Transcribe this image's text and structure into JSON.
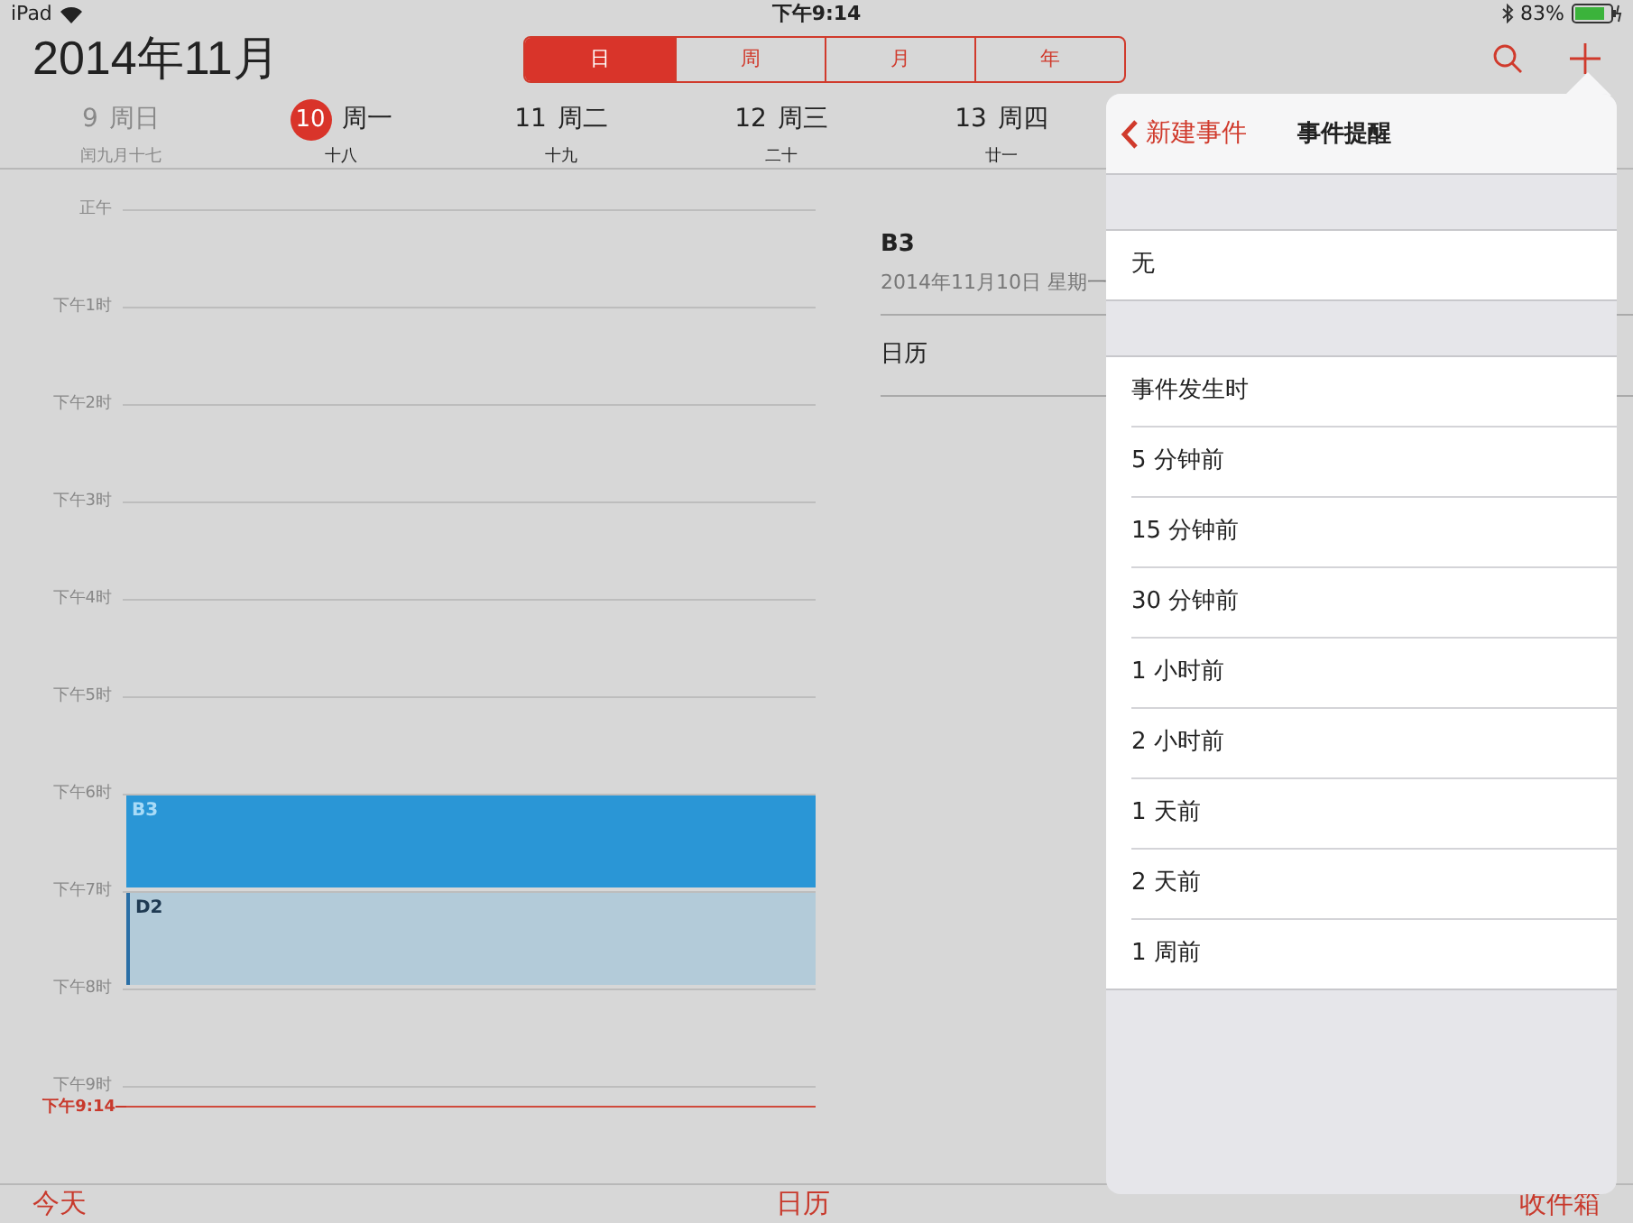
{
  "status_bar": {
    "carrier": "iPad",
    "time": "下午9:14",
    "battery": "83%"
  },
  "header": {
    "title": "2014年11月",
    "segments": [
      {
        "label": "日",
        "selected": true
      },
      {
        "label": "周",
        "selected": false
      },
      {
        "label": "月",
        "selected": false
      },
      {
        "label": "年",
        "selected": false
      }
    ]
  },
  "days": [
    {
      "number": "9",
      "weekday": "周日",
      "lunar": "闰九月十七",
      "today": false,
      "weekend": true
    },
    {
      "number": "10",
      "weekday": "周一",
      "lunar": "十八",
      "today": true,
      "weekend": false
    },
    {
      "number": "11",
      "weekday": "周二",
      "lunar": "十九",
      "today": false,
      "weekend": false
    },
    {
      "number": "12",
      "weekday": "周三",
      "lunar": "二十",
      "today": false,
      "weekend": false
    },
    {
      "number": "13",
      "weekday": "周四",
      "lunar": "廿一",
      "today": false,
      "weekend": false
    }
  ],
  "hours": [
    {
      "label": "正午"
    },
    {
      "label": "下午1时"
    },
    {
      "label": "下午2时"
    },
    {
      "label": "下午3时"
    },
    {
      "label": "下午4时"
    },
    {
      "label": "下午5时"
    },
    {
      "label": "下午6时",
      "events": [
        {
          "title": "B3",
          "selected": true
        }
      ]
    },
    {
      "label": "下午7时",
      "events": [
        {
          "title": "D2",
          "selected": false
        }
      ]
    },
    {
      "label": "下午8时"
    },
    {
      "label": "下午9时",
      "now_marker": "下午9:14"
    }
  ],
  "detail": {
    "title": "B3",
    "date": "2014年11月10日 星期一",
    "calendar": "日历"
  },
  "popover": {
    "back": "新建事件",
    "title": "事件提醒",
    "sections": [
      {
        "items": [
          "无"
        ]
      },
      {
        "items": [
          "事件发生时",
          "5 分钟前",
          "15 分钟前",
          "30 分钟前",
          "1 小时前",
          "2 小时前",
          "1 天前",
          "2 天前",
          "1 周前"
        ]
      }
    ]
  },
  "toolbar": [
    "今天",
    "日历",
    "收件箱"
  ]
}
